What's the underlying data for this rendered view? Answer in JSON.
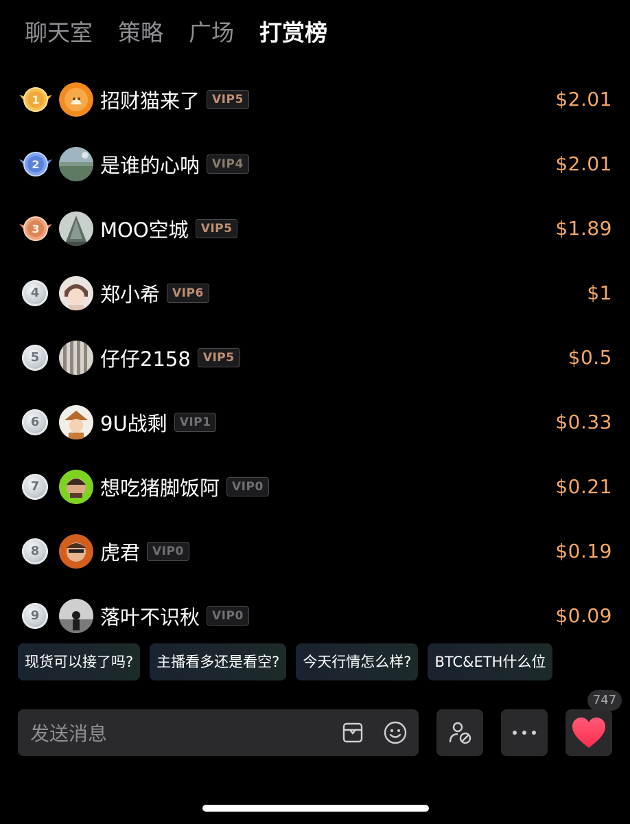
{
  "tabs": [
    {
      "label": "聊天室",
      "active": false
    },
    {
      "label": "策略",
      "active": false
    },
    {
      "label": "广场",
      "active": false
    },
    {
      "label": "打赏榜",
      "active": true
    }
  ],
  "ranking": [
    {
      "rank": "1",
      "name": "招财猫来了",
      "vip": "VIP5",
      "amount": "$2.01"
    },
    {
      "rank": "2",
      "name": "是谁的心呐",
      "vip": "VIP4",
      "amount": "$2.01"
    },
    {
      "rank": "3",
      "name": "MOO空城",
      "vip": "VIP5",
      "amount": "$1.89"
    },
    {
      "rank": "4",
      "name": "郑小希",
      "vip": "VIP6",
      "amount": "$1"
    },
    {
      "rank": "5",
      "name": "仔仔2158",
      "vip": "VIP5",
      "amount": "$0.5"
    },
    {
      "rank": "6",
      "name": "9U战剩",
      "vip": "VIP1",
      "amount": "$0.33"
    },
    {
      "rank": "7",
      "name": "想吃猪脚饭阿",
      "vip": "VIP0",
      "amount": "$0.21"
    },
    {
      "rank": "8",
      "name": "虎君",
      "vip": "VIP0",
      "amount": "$0.19"
    },
    {
      "rank": "9",
      "name": "落叶不识秋",
      "vip": "VIP0",
      "amount": "$0.09"
    }
  ],
  "quick_questions": [
    "现货可以接了吗?",
    "主播看多还是看空?",
    "今天行情怎么样?",
    "BTC&ETH什么位"
  ],
  "input": {
    "placeholder": "发送消息"
  },
  "like_count": "747",
  "icons": {
    "input_left": "card-icon",
    "input_right": "emoji-icon",
    "btn1": "user-block-icon",
    "btn2": "more-icon",
    "btn3": "heart-icon"
  },
  "colors": {
    "background": "#000000",
    "amount": "#f3a868",
    "tab_inactive": "#8e8e93",
    "heart": "#ff3b5c"
  }
}
